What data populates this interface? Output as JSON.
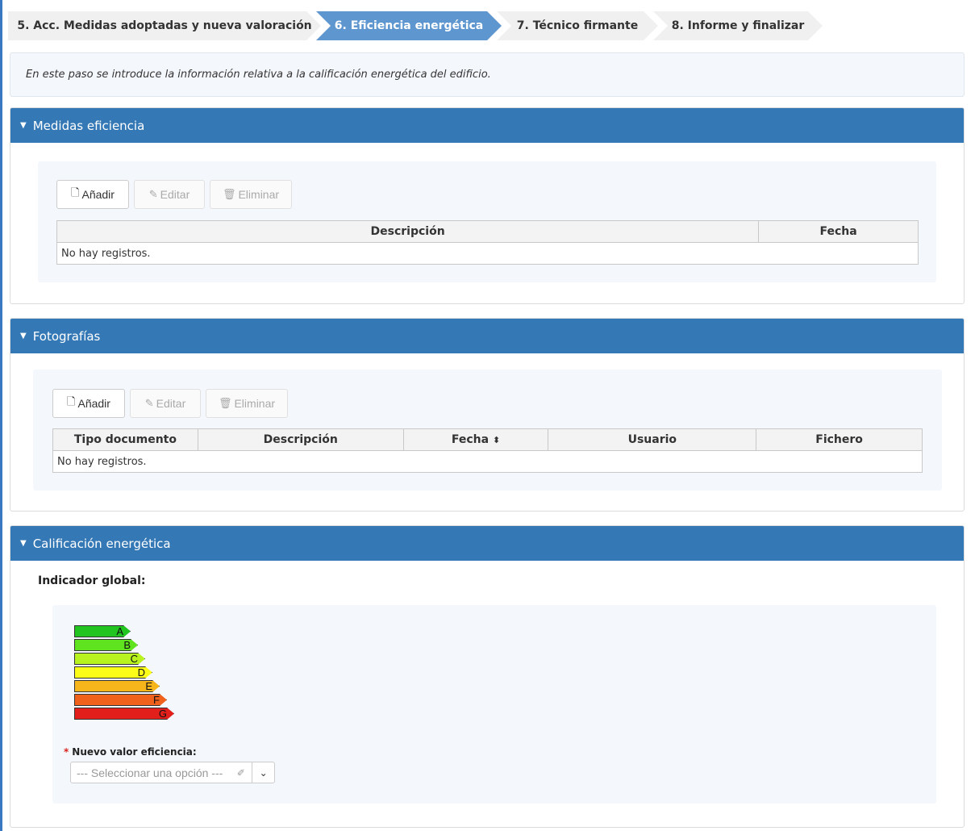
{
  "steps": [
    {
      "label": "5. Acc. Medidas adoptadas y nueva valoración",
      "active": false
    },
    {
      "label": "6. Eficiencia energética",
      "active": true
    },
    {
      "label": "7. Técnico firmante",
      "active": false
    },
    {
      "label": "8. Informe y finalizar",
      "active": false
    }
  ],
  "info_text": "En este paso se introduce la información relativa a la calificación energética del edificio.",
  "medidas": {
    "title": "Medidas eficiencia",
    "buttons": {
      "add": "Añadir",
      "edit": "Editar",
      "delete": "Eliminar"
    },
    "columns": [
      "Descripción",
      "Fecha"
    ],
    "empty": "No hay registros."
  },
  "fotos": {
    "title": "Fotografías",
    "buttons": {
      "add": "Añadir",
      "edit": "Editar",
      "delete": "Eliminar"
    },
    "columns": [
      "Tipo documento",
      "Descripción",
      "Fecha",
      "Usuario",
      "Fichero"
    ],
    "empty": "No hay registros."
  },
  "calificacion": {
    "title": "Calificación energética",
    "indicator_label": "Indicador global:",
    "bars": [
      {
        "letter": "A",
        "color": "#22c41f"
      },
      {
        "letter": "B",
        "color": "#5fe31f"
      },
      {
        "letter": "C",
        "color": "#b8f21f"
      },
      {
        "letter": "D",
        "color": "#fcfc19"
      },
      {
        "letter": "E",
        "color": "#f7b51c"
      },
      {
        "letter": "F",
        "color": "#f0611c"
      },
      {
        "letter": "G",
        "color": "#e31f1c"
      }
    ],
    "field_label": "Nuevo valor eficiencia:",
    "select_placeholder": "--- Seleccionar una opción ---"
  },
  "icons": {
    "caret": "caret-down-icon",
    "add": "file-icon",
    "edit": "edit-icon",
    "delete": "trash-icon",
    "sort": "sort-icon",
    "eraser": "eraser-icon",
    "chevron": "chevron-down-icon"
  },
  "colors": {
    "panel_header": "#3478b5",
    "active_step": "#5e97d0",
    "required": "#d9231d"
  }
}
